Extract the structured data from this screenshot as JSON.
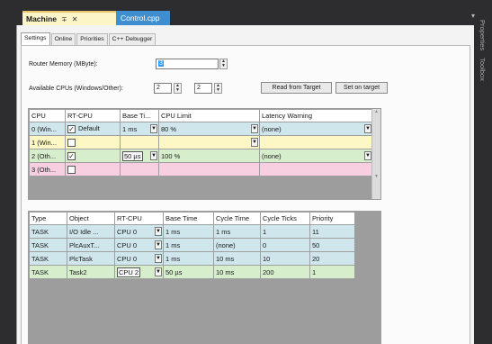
{
  "tabs": {
    "active_label": "Machine",
    "pin_icon": "pin-icon",
    "close_icon": "close-icon",
    "inactive_label": "Control.cpp"
  },
  "side_panels": [
    "Properties",
    "Toolbox"
  ],
  "subtabs": [
    "Settings",
    "Online",
    "Priorities",
    "C++ Debugger"
  ],
  "router_memory": {
    "label": "Router Memory (MByte):",
    "value": "3"
  },
  "cpus": {
    "label": "Available CPUs (Windows/Other):",
    "windows": "2",
    "other": "2"
  },
  "buttons": {
    "read_from_target": "Read from Target",
    "set_on_target": "Set on target"
  },
  "cpu_table": {
    "headers": [
      "CPU",
      "RT-CPU",
      "Base Ti...",
      "CPU Limit",
      "Latency Warning"
    ],
    "rows": [
      {
        "cpu": "0 (Win...",
        "rt_checked": true,
        "rt_label": "Default",
        "base_time": "1 ms",
        "limit": "80 %",
        "latency": "(none)",
        "color": "blue"
      },
      {
        "cpu": "1 (Win...",
        "rt_checked": false,
        "rt_label": "",
        "base_time": "",
        "limit": "",
        "latency": "",
        "color": "yellow"
      },
      {
        "cpu": "2 (Oth...",
        "rt_checked": true,
        "rt_label": "",
        "base_time": "50 µs",
        "limit": "100 %",
        "latency": "(none)",
        "color": "green"
      },
      {
        "cpu": "3 (Oth...",
        "rt_checked": false,
        "rt_label": "",
        "base_time": "",
        "limit": "",
        "latency": "",
        "color": "pink"
      }
    ]
  },
  "task_table": {
    "headers": [
      "Type",
      "Object",
      "RT-CPU",
      "Base Time",
      "Cycle Time",
      "Cycle Ticks",
      "Priority"
    ],
    "rows": [
      {
        "type": "TASK",
        "object": "I/O Idle ...",
        "rt_cpu": "CPU 0",
        "base_time": "1 ms",
        "cycle_time": "1 ms",
        "ticks": "1",
        "priority": "11",
        "color": "blue"
      },
      {
        "type": "TASK",
        "object": "PlcAuxT...",
        "rt_cpu": "CPU 0",
        "base_time": "1 ms",
        "cycle_time": "(none)",
        "ticks": "0",
        "priority": "50",
        "color": "blue"
      },
      {
        "type": "TASK",
        "object": "PlcTask",
        "rt_cpu": "CPU 0",
        "base_time": "1 ms",
        "cycle_time": "10 ms",
        "ticks": "10",
        "priority": "20",
        "color": "blue"
      },
      {
        "type": "TASK",
        "object": "Task2",
        "rt_cpu": "CPU 2",
        "base_time": "50 µs",
        "cycle_time": "10 ms",
        "ticks": "200",
        "priority": "1",
        "color": "green"
      }
    ]
  },
  "colors": {
    "blue": "#cfe6ec",
    "yellow": "#fdf7c6",
    "green": "#d7eecd",
    "pink": "#f7cfe0",
    "accent": "#3f8fd0"
  }
}
